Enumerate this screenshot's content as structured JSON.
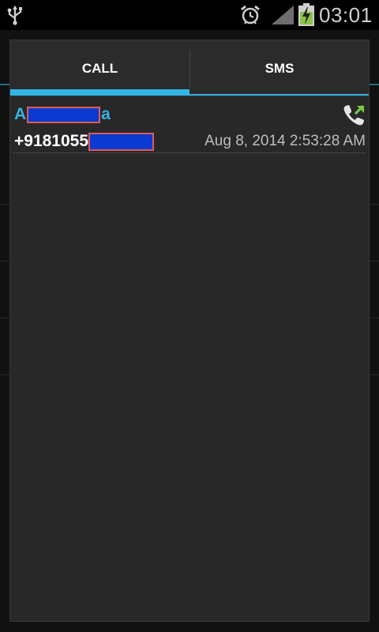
{
  "status_bar": {
    "time": "03:01",
    "icons": [
      "usb-icon",
      "alarm-icon",
      "signal-icon",
      "battery-charging-icon"
    ]
  },
  "dialog": {
    "tabs": [
      {
        "label": "CALL",
        "selected": true
      },
      {
        "label": "SMS",
        "selected": false
      }
    ],
    "entries": [
      {
        "name_prefix": "A",
        "name_suffix": "a",
        "number_prefix": "+9181055",
        "datetime": "Aug 8, 2014 2:53:28 AM",
        "call_type_icon": "outgoing-call-icon"
      }
    ]
  },
  "colors": {
    "accent": "#33b5e5",
    "dialog_bg": "#282828",
    "redaction_fill": "#0a3ad0",
    "redaction_border": "#e05a5a",
    "outgoing_arrow": "#7ac943"
  }
}
